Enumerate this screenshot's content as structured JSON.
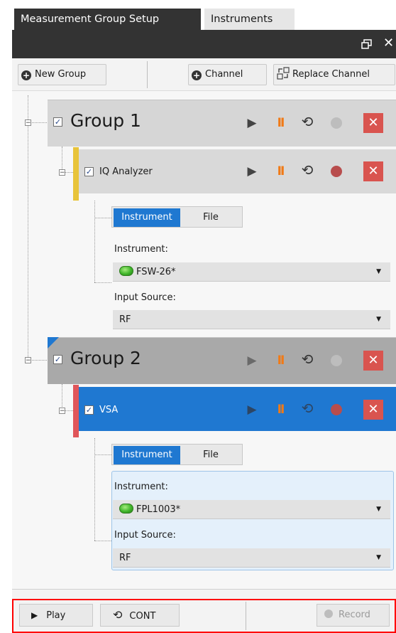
{
  "tabs": [
    {
      "label": "Measurement Group Setup",
      "active": true
    },
    {
      "label": "Instruments",
      "active": false
    }
  ],
  "window_controls": {
    "restore_icon": "restore-window-icon",
    "close_icon": "close-icon",
    "close_glyph": "✕"
  },
  "toolbar": {
    "new_group_label": "New Group",
    "channel_label": "Channel",
    "replace_channel_label": "Replace Channel"
  },
  "groups": [
    {
      "title": "Group 1",
      "checked": true,
      "channel": {
        "name": "IQ Analyzer",
        "checked": true,
        "color": "#e8c43a",
        "record_color": "#b84d4d",
        "subtabs": [
          "Instrument",
          "File"
        ],
        "instrument_label": "Instrument:",
        "instrument_value": "FSW-26*",
        "input_source_label": "Input Source:",
        "input_source_value": "RF"
      },
      "record_color": "#bdbdbd"
    },
    {
      "title": "Group 2",
      "checked": true,
      "selected_marker_color": "#1f78d1",
      "channel": {
        "name": "VSA",
        "checked": true,
        "color": "#e0565a",
        "highlight": "#1f78d1",
        "record_color": "#b84d4d",
        "subtabs": [
          "Instrument",
          "File"
        ],
        "instrument_label": "Instrument:",
        "instrument_value": "FPL1003*",
        "input_source_label": "Input Source:",
        "input_source_value": "RF"
      },
      "record_color": "#bdbdbd"
    }
  ],
  "controls": {
    "play_glyph": "▶",
    "pause_glyph": "II",
    "continuous_glyph": "⟲",
    "close_glyph": "✕",
    "collapse_glyph": "−",
    "check_glyph": "✓",
    "dropdown_arrow": "▼"
  },
  "bottom": {
    "play_label": "Play",
    "cont_label": "CONT",
    "record_label": "Record",
    "play_glyph": "▶",
    "cont_glyph": "⟲"
  },
  "colors": {
    "accent_blue": "#1f78d1",
    "pause_orange": "#f07a17",
    "close_red": "#d9544f",
    "highlight_frame": "#ff0000"
  }
}
